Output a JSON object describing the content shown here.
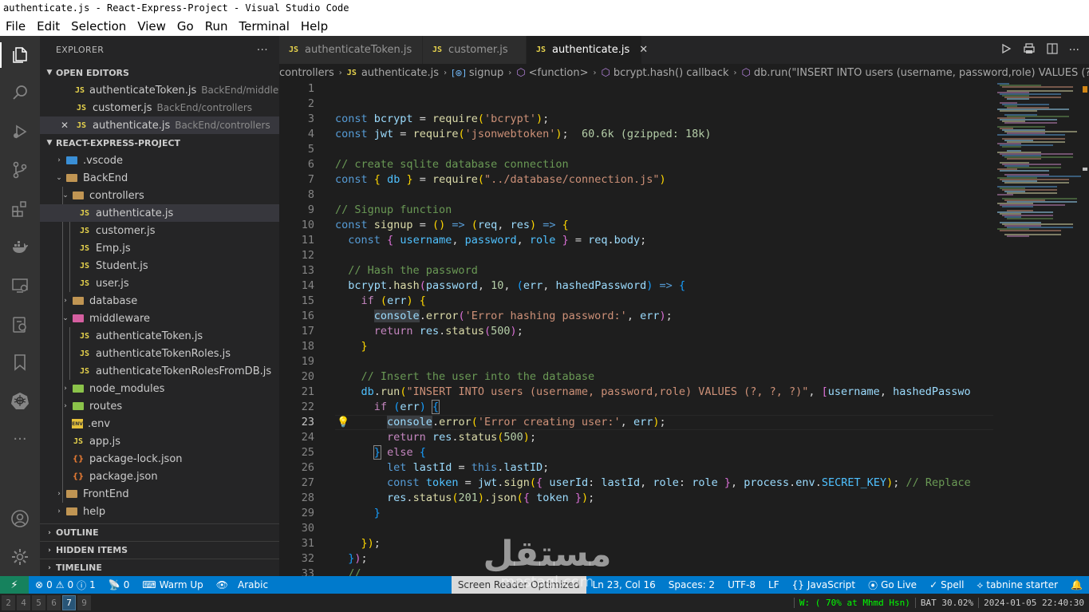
{
  "window": {
    "title": "authenticate.js - React-Express-Project - Visual Studio Code"
  },
  "menu": [
    "File",
    "Edit",
    "Selection",
    "View",
    "Go",
    "Run",
    "Terminal",
    "Help"
  ],
  "activity": [
    "explorer-icon",
    "search-icon",
    "run-debug-icon",
    "source-control-icon",
    "extensions-icon",
    "docker-icon",
    "remote-explorer-icon",
    "settings-sync-icon",
    "bookmarks-icon",
    "kubernetes-icon",
    "more-icon",
    "account-icon",
    "manage-gear-icon"
  ],
  "sidebar": {
    "title": "EXPLORER",
    "more": "···",
    "open_editors": {
      "label": "OPEN EDITORS",
      "items": [
        {
          "name": "authenticateToken.js",
          "desc": "BackEnd/middlew..."
        },
        {
          "name": "customer.js",
          "desc": "BackEnd/controllers"
        },
        {
          "name": "authenticate.js",
          "desc": "BackEnd/controllers"
        }
      ]
    },
    "project": {
      "label": "REACT-EXPRESS-PROJECT",
      "tree": [
        ".vscode",
        "BackEnd",
        "controllers",
        "authenticate.js",
        "customer.js",
        "Emp.js",
        "Student.js",
        "user.js",
        "database",
        "middleware",
        "authenticateToken.js",
        "authenticateTokenRoles.js",
        "authenticateTokenRolesFromDB.js",
        "node_modules",
        "routes",
        ".env",
        "app.js",
        "package-lock.json",
        "package.json",
        "FrontEnd",
        "help"
      ]
    },
    "bottom_sections": [
      "OUTLINE",
      "HIDDEN ITEMS",
      "TIMELINE"
    ]
  },
  "tabs": [
    {
      "label": "authenticateToken.js",
      "icon": "JS"
    },
    {
      "label": "customer.js",
      "icon": "JS"
    },
    {
      "label": "authenticate.js",
      "icon": "JS",
      "close": "✕"
    }
  ],
  "breadcrumb": [
    "controllers",
    "authenticate.js",
    "signup",
    "<function>",
    "bcrypt.hash() callback",
    "db.run(\"INSERT INTO users (username, password,role) VALUES (?, ?, ?)\") callback"
  ],
  "editor": {
    "line_numbers": [
      "1",
      "2",
      "3",
      "4",
      "5",
      "6",
      "7",
      "8",
      "9",
      "10",
      "11",
      "12",
      "13",
      "14",
      "15",
      "16",
      "17",
      "18",
      "19",
      "20",
      "21",
      "22",
      "23",
      "24",
      "25",
      "26",
      "27",
      "28",
      "29",
      "30",
      "31",
      "32",
      "33"
    ],
    "current_line": "23",
    "import_cost": "60.6k (gzipped: 18k)"
  },
  "status": {
    "errors": "0",
    "warnings": "0",
    "info": "1",
    "ports": "0",
    "warm_up": "Warm Up",
    "language_kb": "Arabic",
    "screen_reader": "Screen Reader Optimized",
    "cursor": "Ln 23, Col 16",
    "spaces": "Spaces: 2",
    "encoding": "UTF-8",
    "eol": "LF",
    "language": "JavaScript",
    "golive": "Go Live",
    "spell": "Spell",
    "tabnine": "tabnine starter"
  },
  "taskbar": {
    "workspaces": [
      "2",
      "4",
      "5",
      "6",
      "7",
      "9"
    ],
    "active": "7",
    "wifi": "W: ( 70% at Mhmd Hsn)",
    "battery": "BAT 30.02%",
    "datetime": "2024-01-05 22:40:30"
  },
  "watermark": {
    "logo": "مستقل",
    "site": "mostaql.com"
  }
}
